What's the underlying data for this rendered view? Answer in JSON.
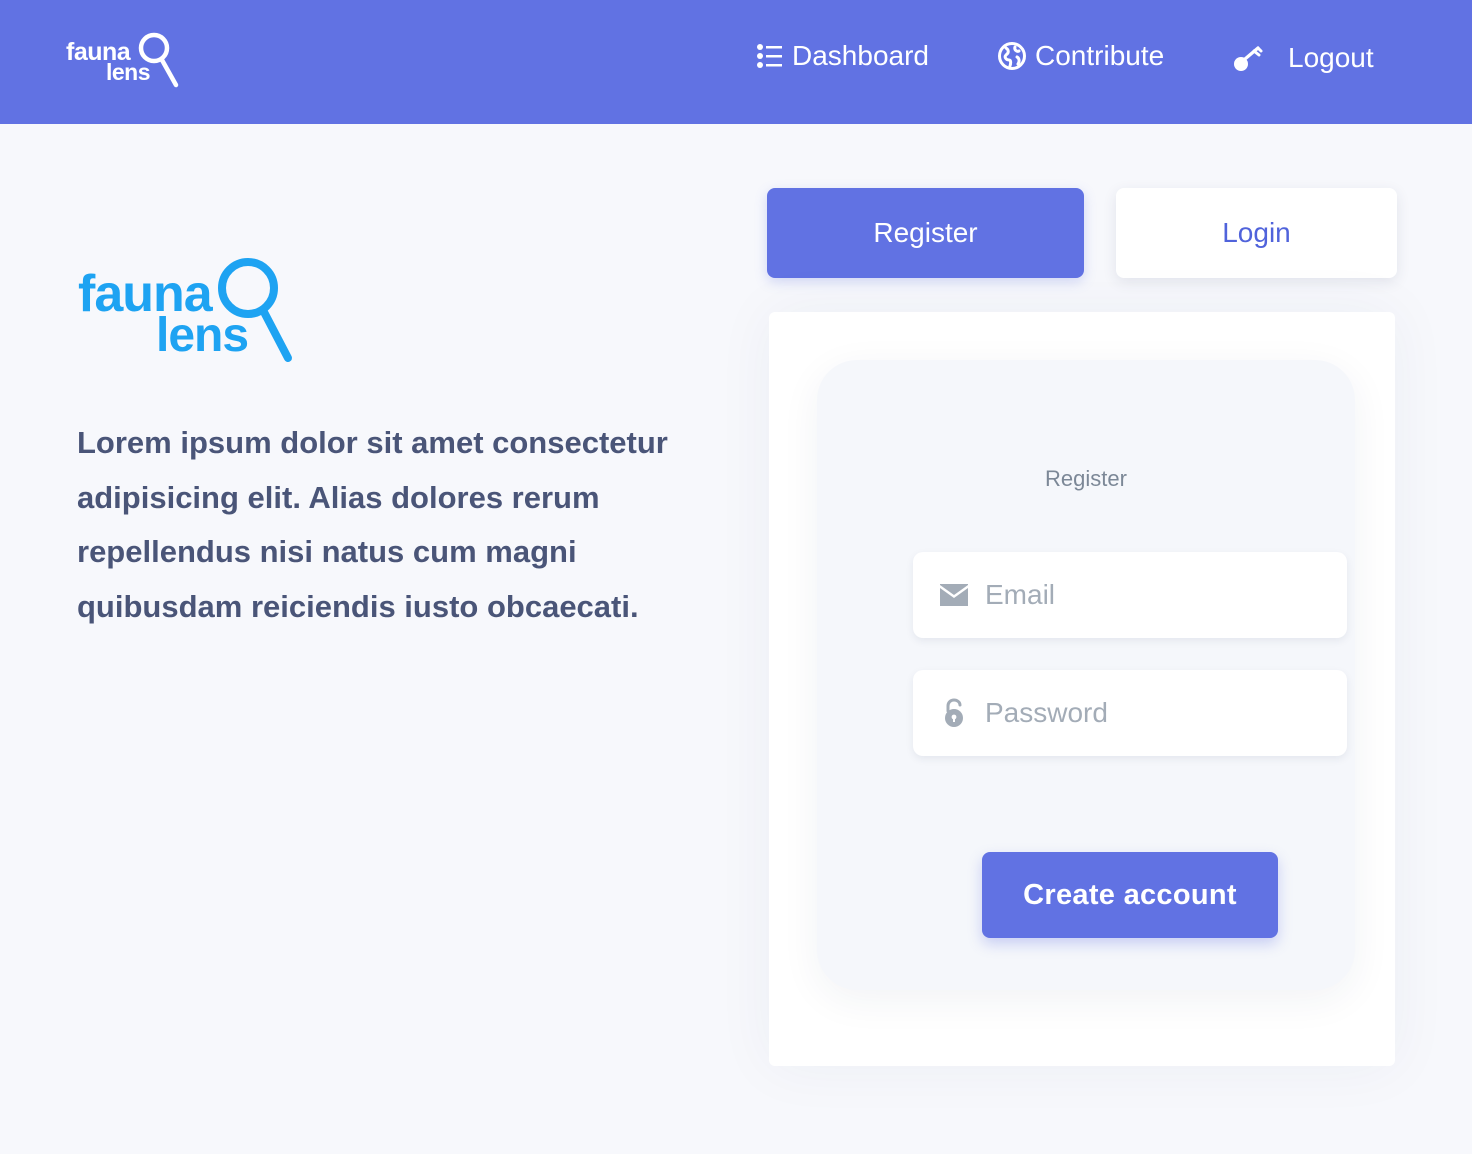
{
  "header": {
    "logo": {
      "line1": "fauna",
      "line2": "lens"
    },
    "nav": {
      "dashboard": {
        "label": "Dashboard",
        "icon": "list-icon"
      },
      "contribute": {
        "label": "Contribute",
        "icon": "globe-icon"
      },
      "logout": {
        "label": "Logout",
        "icon": "key-icon"
      }
    }
  },
  "hero": {
    "logo": {
      "line1": "fauna",
      "line2": "lens"
    },
    "text": "Lorem ipsum dolor sit amet consectetur adipisicing elit. Alias dolores rerum repellendus nisi natus cum magni quibusdam reiciendis iusto obcaecati."
  },
  "tabs": {
    "register": "Register",
    "login": "Login",
    "active": "register"
  },
  "form": {
    "title": "Register",
    "email": {
      "placeholder": "Email",
      "value": "",
      "icon": "envelope-icon"
    },
    "password": {
      "placeholder": "Password",
      "value": "",
      "icon": "unlock-icon"
    },
    "submit_label": "Create account"
  },
  "colors": {
    "primary": "#6172e3",
    "brand_blue": "#1ea3f2",
    "text_dark": "#4a5578",
    "page_bg": "#f7f8fc"
  }
}
